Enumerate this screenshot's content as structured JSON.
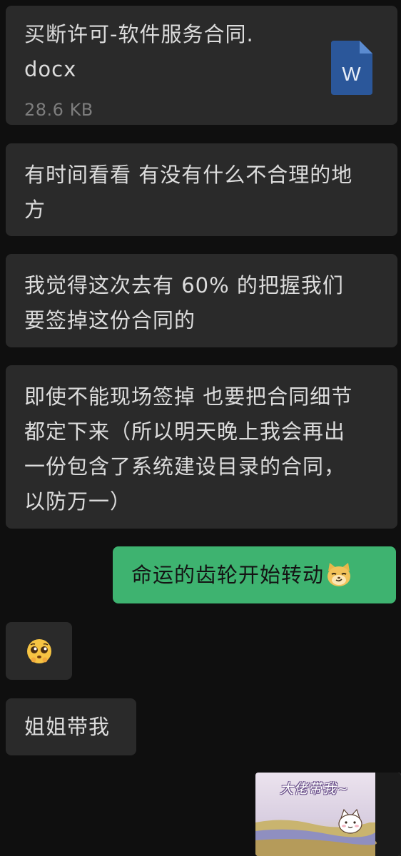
{
  "file_message": {
    "file_name": "买断许可-软件服务合同.\ndocx",
    "file_size": "28.6 KB",
    "file_type_letter": "W",
    "icon": "word-document-icon"
  },
  "messages": [
    {
      "text": "有时间看看 有没有什么不合理的地\n方"
    },
    {
      "text": "我觉得这次去有 60% 的把握我们\n要签掉这份合同的"
    },
    {
      "text": "即使不能现场签掉 也要把合同细节\n都定下来（所以明天晚上我会再出\n一份包含了系统建设目录的合同，\n以防万一）"
    }
  ],
  "sent_message": {
    "text": "命运的齿轮开始转动",
    "emoji": "doge-cat-emoji"
  },
  "emoji_message": {
    "emoji": "pleading-face-emoji"
  },
  "last_text_message": {
    "text": "姐姐带我"
  },
  "sticker": {
    "caption": "大佬带我~",
    "image": "cat-sticker"
  },
  "colors": {
    "background": "#0f0f0f",
    "received_bubble": "#2a2a2a",
    "sent_bubble": "#3eb370",
    "word_icon": "#2b579a"
  }
}
